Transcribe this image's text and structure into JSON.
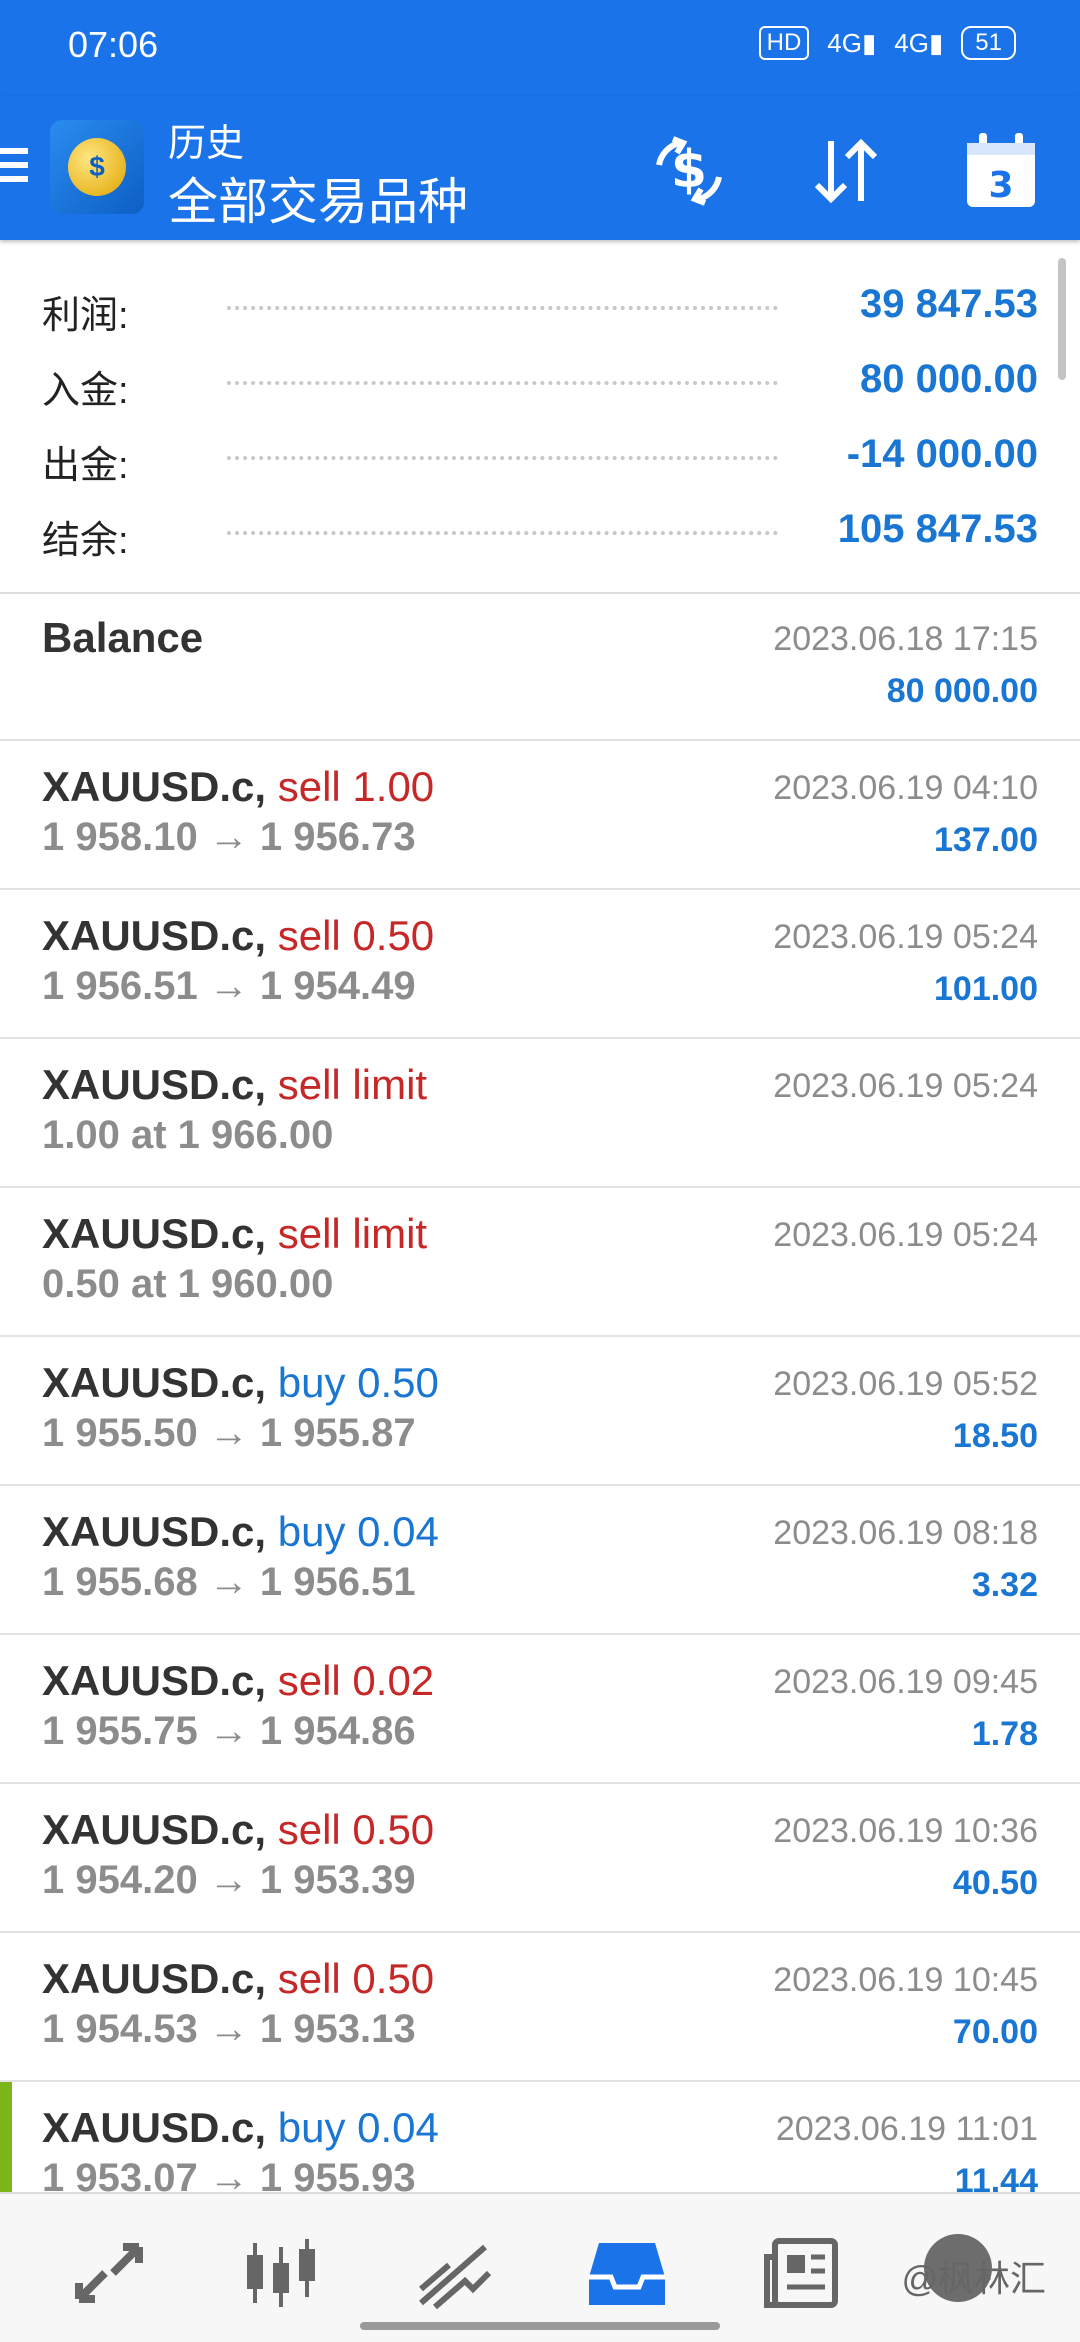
{
  "status_bar": {
    "time": "07:06",
    "hd_badge": "HD",
    "signal1": "4G",
    "signal2": "4G",
    "battery": "51"
  },
  "app_bar": {
    "subtitle": "历史",
    "title": "全部交易品种",
    "icons": [
      "hamburger-menu-icon",
      "metatrader-logo",
      "dollar-exchange-icon",
      "sort-icon",
      "calendar-icon"
    ],
    "calendar_day": "3"
  },
  "summary": [
    {
      "label": "利润:",
      "value": "39 847.53"
    },
    {
      "label": "入金:",
      "value": "80 000.00"
    },
    {
      "label": "出金:",
      "value": "-14 000.00"
    },
    {
      "label": "结余:",
      "value": "105 847.53"
    }
  ],
  "records": [
    {
      "symbol": "Balance",
      "action": "",
      "type": "",
      "detail": "",
      "date": "2023.06.18 17:15",
      "amount": "80 000.00"
    },
    {
      "symbol": "XAUUSD.c,",
      "action": "sell 1.00",
      "type": "sell",
      "detail": "1 958.10 → 1 956.73",
      "date": "2023.06.19 04:10",
      "amount": "137.00"
    },
    {
      "symbol": "XAUUSD.c,",
      "action": "sell 0.50",
      "type": "sell",
      "detail": "1 956.51 → 1 954.49",
      "date": "2023.06.19 05:24",
      "amount": "101.00"
    },
    {
      "symbol": "XAUUSD.c,",
      "action": "sell limit",
      "type": "sell",
      "detail": "1.00 at 1 966.00",
      "date": "2023.06.19 05:24",
      "amount": ""
    },
    {
      "symbol": "XAUUSD.c,",
      "action": "sell limit",
      "type": "sell",
      "detail": "0.50 at 1 960.00",
      "date": "2023.06.19 05:24",
      "amount": ""
    },
    {
      "symbol": "XAUUSD.c,",
      "action": "buy 0.50",
      "type": "buy",
      "detail": "1 955.50 → 1 955.87",
      "date": "2023.06.19 05:52",
      "amount": "18.50"
    },
    {
      "symbol": "XAUUSD.c,",
      "action": "buy 0.04",
      "type": "buy",
      "detail": "1 955.68 → 1 956.51",
      "date": "2023.06.19 08:18",
      "amount": "3.32"
    },
    {
      "symbol": "XAUUSD.c,",
      "action": "sell 0.02",
      "type": "sell",
      "detail": "1 955.75 → 1 954.86",
      "date": "2023.06.19 09:45",
      "amount": "1.78"
    },
    {
      "symbol": "XAUUSD.c,",
      "action": "sell 0.50",
      "type": "sell",
      "detail": "1 954.20 → 1 953.39",
      "date": "2023.06.19 10:36",
      "amount": "40.50"
    },
    {
      "symbol": "XAUUSD.c,",
      "action": "sell 0.50",
      "type": "sell",
      "detail": "1 954.53 → 1 953.13",
      "date": "2023.06.19 10:45",
      "amount": "70.00"
    },
    {
      "symbol": "XAUUSD.c,",
      "action": "buy 0.04",
      "type": "buy",
      "detail": "1 953.07 → 1 955.93",
      "date": "2023.06.19 11:01",
      "amount": "11.44"
    }
  ],
  "bottom_nav": {
    "items": [
      "quotes-icon",
      "chart-icon",
      "trade-icon",
      "history-icon",
      "news-icon"
    ],
    "active": "history-icon",
    "watermark": "@枫林汇"
  },
  "colors": {
    "primary": "#1a73e8",
    "sell": "#c62828",
    "buy": "#1976d2",
    "value": "#1976d2"
  }
}
